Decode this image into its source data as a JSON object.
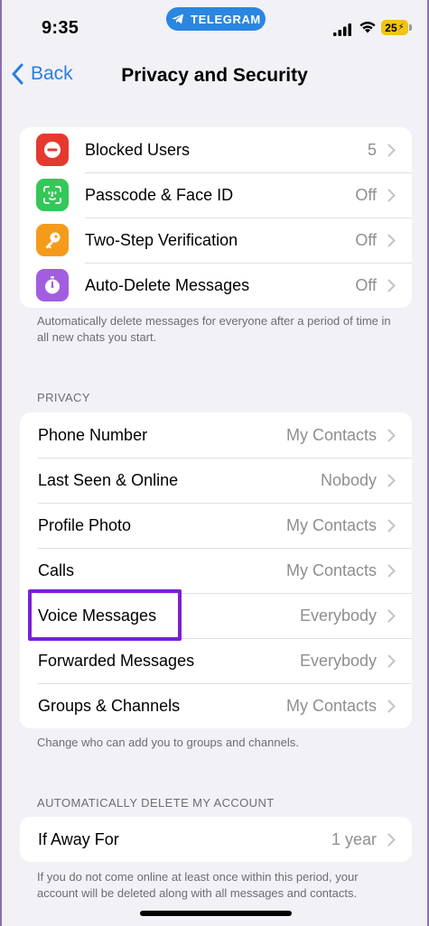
{
  "status": {
    "time": "9:35",
    "pill_label": "TELEGRAM",
    "battery": "25"
  },
  "nav": {
    "back_label": "Back",
    "title": "Privacy and Security"
  },
  "security": {
    "items": [
      {
        "label": "Blocked Users",
        "value": "5",
        "icon": "blocked-icon",
        "color": "#e5392f"
      },
      {
        "label": "Passcode & Face ID",
        "value": "Off",
        "icon": "face-id-icon",
        "color": "#34c759"
      },
      {
        "label": "Two-Step Verification",
        "value": "Off",
        "icon": "key-icon",
        "color": "#f59b1b"
      },
      {
        "label": "Auto-Delete Messages",
        "value": "Off",
        "icon": "timer-icon",
        "color": "#a25de0"
      }
    ],
    "footer": "Automatically delete messages for everyone after a period of time in all new chats you start."
  },
  "privacy": {
    "header": "PRIVACY",
    "items": [
      {
        "label": "Phone Number",
        "value": "My Contacts"
      },
      {
        "label": "Last Seen & Online",
        "value": "Nobody"
      },
      {
        "label": "Profile Photo",
        "value": "My Contacts"
      },
      {
        "label": "Calls",
        "value": "My Contacts"
      },
      {
        "label": "Voice Messages",
        "value": "Everybody"
      },
      {
        "label": "Forwarded Messages",
        "value": "Everybody"
      },
      {
        "label": "Groups & Channels",
        "value": "My Contacts"
      }
    ],
    "footer": "Change who can add you to groups and channels."
  },
  "account": {
    "header": "AUTOMATICALLY DELETE MY ACCOUNT",
    "items": [
      {
        "label": "If Away For",
        "value": "1 year"
      }
    ],
    "footer": "If you do not come online at least once within this period, your account will be deleted along with all messages and contacts."
  },
  "colors": {
    "accent": "#2a7de1",
    "highlight": "#7a1fd8",
    "background": "#f2f1f6"
  }
}
